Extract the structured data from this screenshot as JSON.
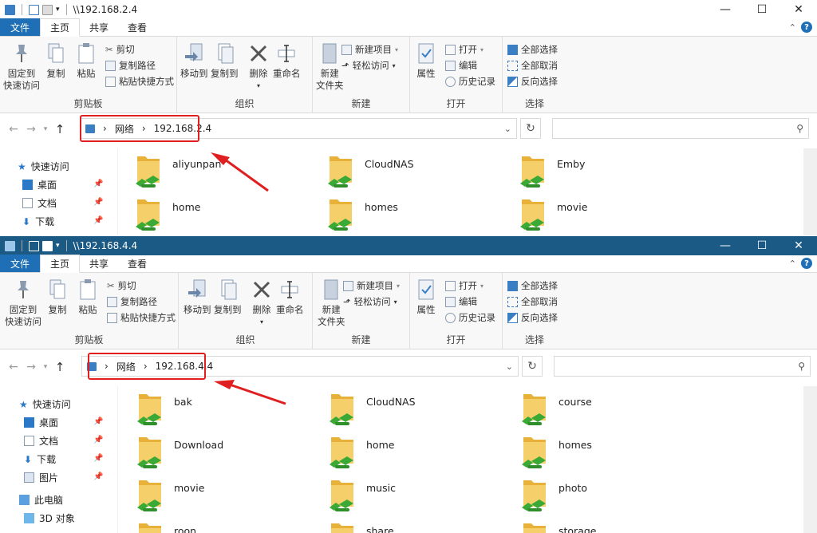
{
  "ribbon": {
    "tabs": [
      "文件",
      "主页",
      "共享",
      "查看"
    ],
    "pin_label_1": "固定到",
    "pin_label_2": "快速访问",
    "copy": "复制",
    "paste": "粘贴",
    "cut": "剪切",
    "copy_path": "复制路径",
    "paste_shortcut": "粘贴快捷方式",
    "clipboard_group": "剪贴板",
    "move_to": "移动到",
    "copy_to": "复制到",
    "delete": "删除",
    "rename": "重命名",
    "organize_group": "组织",
    "new_folder_1": "新建",
    "new_folder_2": "文件夹",
    "new_item": "新建项目",
    "easy_access": "轻松访问",
    "new_group": "新建",
    "properties": "属性",
    "open": "打开",
    "edit": "编辑",
    "history": "历史记录",
    "open_group": "打开",
    "select_all": "全部选择",
    "select_none": "全部取消",
    "invert_selection": "反向选择",
    "select_group": "选择"
  },
  "sidebar": {
    "quick_access": "快速访问",
    "desktop": "桌面",
    "documents": "文档",
    "downloads": "下载",
    "pictures": "图片",
    "this_pc": "此电脑",
    "objects_3d": "3D 对象"
  },
  "window1": {
    "title": "\\\\192.168.2.4",
    "crumb_root": "网络",
    "crumb_host": "192.168.2.4",
    "folders": [
      "aliyunpan",
      "CloudNAS",
      "Emby",
      "home",
      "homes",
      "movie"
    ]
  },
  "window2": {
    "title": "\\\\192.168.4.4",
    "crumb_root": "网络",
    "crumb_host": "192.168.4.4",
    "folders": [
      "bak",
      "CloudNAS",
      "course",
      "Download",
      "home",
      "homes",
      "movie",
      "music",
      "photo",
      "roon",
      "share",
      "storage"
    ]
  },
  "colors": {
    "file_tab": "#1e6fb5",
    "active_titlebar": "#1b5a85",
    "highlight_red": "#e02020",
    "folder_yellow": "#f2c94c",
    "share_green": "#3aa935"
  }
}
